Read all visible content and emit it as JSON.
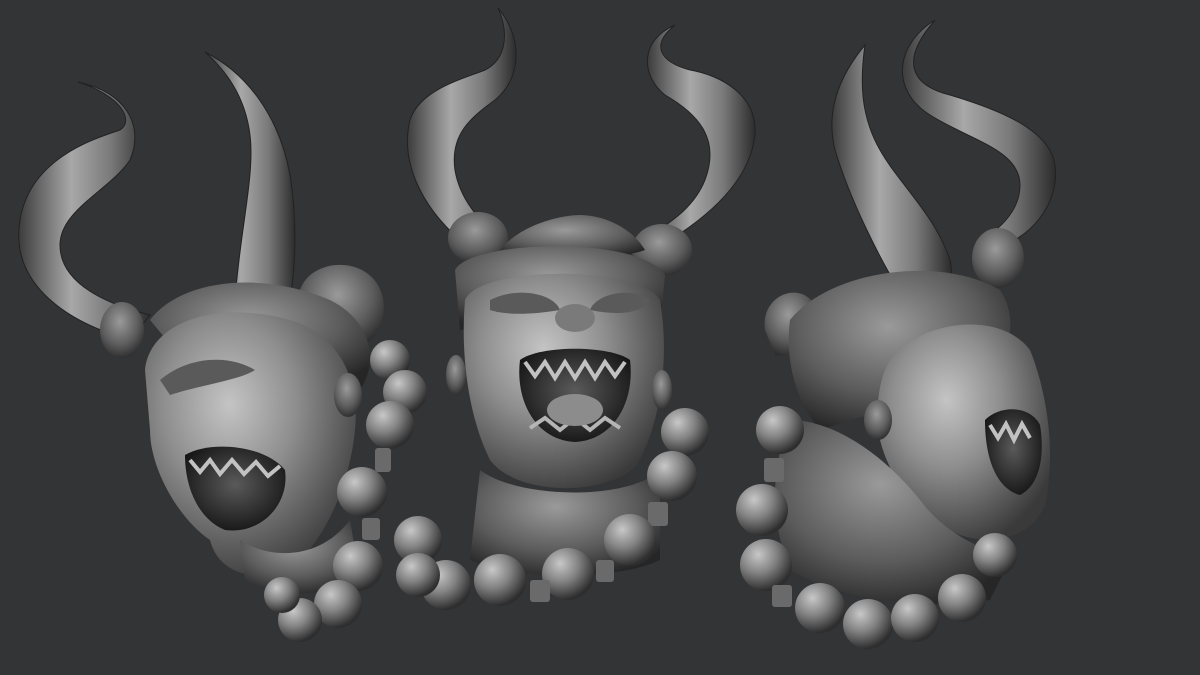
{
  "scene": {
    "background_color": "#333436",
    "material_light": "#b9b9b9",
    "material_mid": "#8a8a8a",
    "material_dark": "#4a4a4a",
    "material_shadow": "#1e1e1e",
    "subject": "horned-demon-head-sculpt",
    "views": [
      {
        "id": "three-quarter-left",
        "has_horns": true,
        "has_bead_necklace": true
      },
      {
        "id": "front",
        "has_horns": true,
        "has_bead_necklace": true
      },
      {
        "id": "three-quarter-right",
        "has_horns": true,
        "has_bead_necklace": true
      }
    ]
  }
}
